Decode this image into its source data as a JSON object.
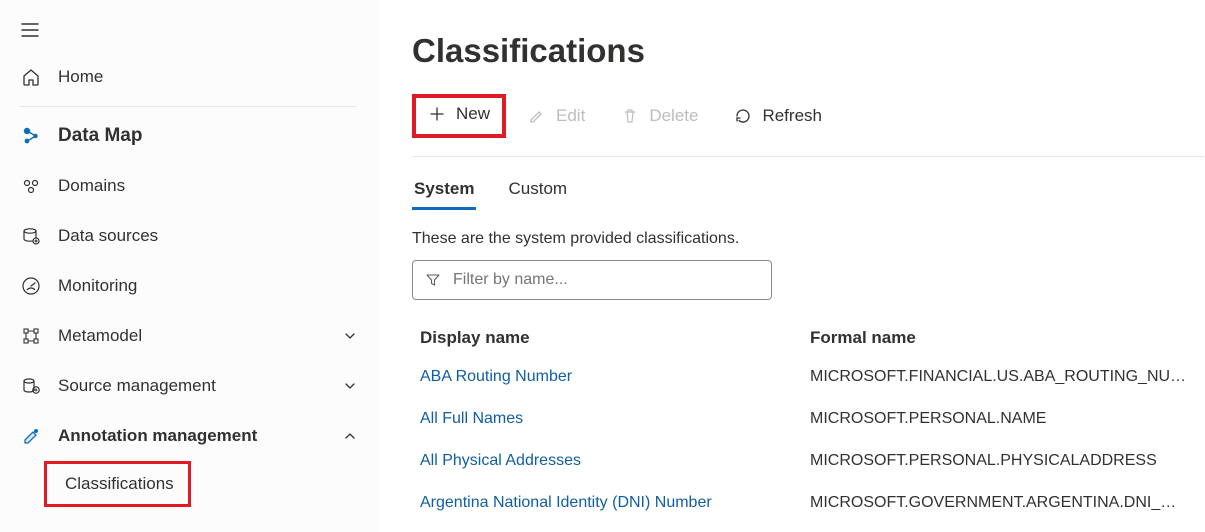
{
  "sidebar": {
    "home_label": "Home",
    "section_label": "Data Map",
    "items": [
      {
        "label": "Domains",
        "expandable": false
      },
      {
        "label": "Data sources",
        "expandable": false
      },
      {
        "label": "Monitoring",
        "expandable": false
      },
      {
        "label": "Metamodel",
        "expandable": true,
        "expanded": false
      },
      {
        "label": "Source management",
        "expandable": true,
        "expanded": false
      },
      {
        "label": "Annotation management",
        "expandable": true,
        "expanded": true
      }
    ],
    "subitem_label": "Classifications"
  },
  "page": {
    "title": "Classifications"
  },
  "toolbar": {
    "new_label": "New",
    "edit_label": "Edit",
    "delete_label": "Delete",
    "refresh_label": "Refresh"
  },
  "tabs": {
    "system_label": "System",
    "custom_label": "Custom"
  },
  "helper_text": "These are the system provided classifications.",
  "filter": {
    "placeholder": "Filter by name..."
  },
  "columns": {
    "display": "Display name",
    "formal": "Formal name"
  },
  "rows": [
    {
      "display": "ABA Routing Number",
      "formal": "MICROSOFT.FINANCIAL.US.ABA_ROUTING_NU…"
    },
    {
      "display": "All Full Names",
      "formal": "MICROSOFT.PERSONAL.NAME"
    },
    {
      "display": "All Physical Addresses",
      "formal": "MICROSOFT.PERSONAL.PHYSICALADDRESS"
    },
    {
      "display": "Argentina National Identity (DNI) Number",
      "formal": "MICROSOFT.GOVERNMENT.ARGENTINA.DNI_…"
    }
  ]
}
